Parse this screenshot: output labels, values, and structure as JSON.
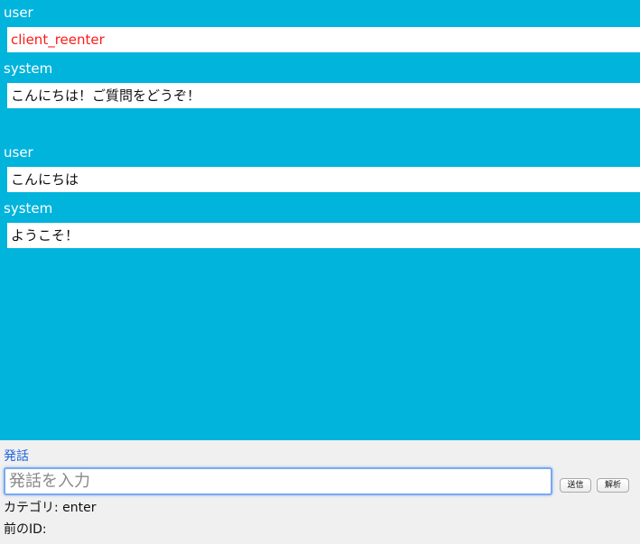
{
  "conversation": [
    {
      "role": "user",
      "text": "client_reenter"
    },
    {
      "role": "system",
      "text": "こんにちは！ご質問をどうぞ！"
    },
    {
      "role": "user",
      "text": "こんにちは"
    },
    {
      "role": "system",
      "text": "ようこそ！"
    }
  ],
  "colors": {
    "chat_background": "#00b4dc",
    "special_message": "#ff1a1a",
    "label_blue": "#2266dd"
  },
  "form": {
    "label": "発話",
    "input_placeholder": "発話を入力",
    "input_value": "",
    "send_label": "送信",
    "analyze_label": "解析",
    "category_text": "カテゴリ: enter",
    "previous_id_text": "前のID:"
  }
}
